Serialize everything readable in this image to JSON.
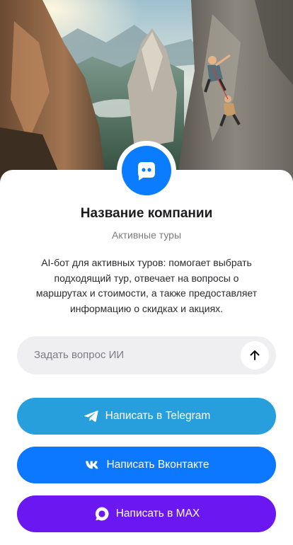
{
  "colors": {
    "avatar": "#0A7CFF",
    "telegram": "#279FDD",
    "vkontakte": "#0C77FF",
    "max": "#6A17F1",
    "input_background": "#EFEFF1"
  },
  "hero": {
    "image": "mountain-climbers-photo"
  },
  "avatar": {
    "icon": "chat-bot-icon"
  },
  "company": {
    "name": "Название компании",
    "category": "Активные туры",
    "description": "AI-бот для активных туров: помогает выбрать подходящий тур, отвечает на вопросы о маршрутах и стоимости, а также предоставляет информацию о скидках и акциях."
  },
  "ask": {
    "placeholder": "Задать вопрос ИИ",
    "send_icon": "arrow-up-icon"
  },
  "buttons": [
    {
      "label": "Написать в Telegram",
      "icon": "telegram-icon"
    },
    {
      "label": "Написать Вконтакте",
      "icon": "vk-icon"
    },
    {
      "label": "Написать в MAX",
      "icon": "max-icon"
    }
  ]
}
